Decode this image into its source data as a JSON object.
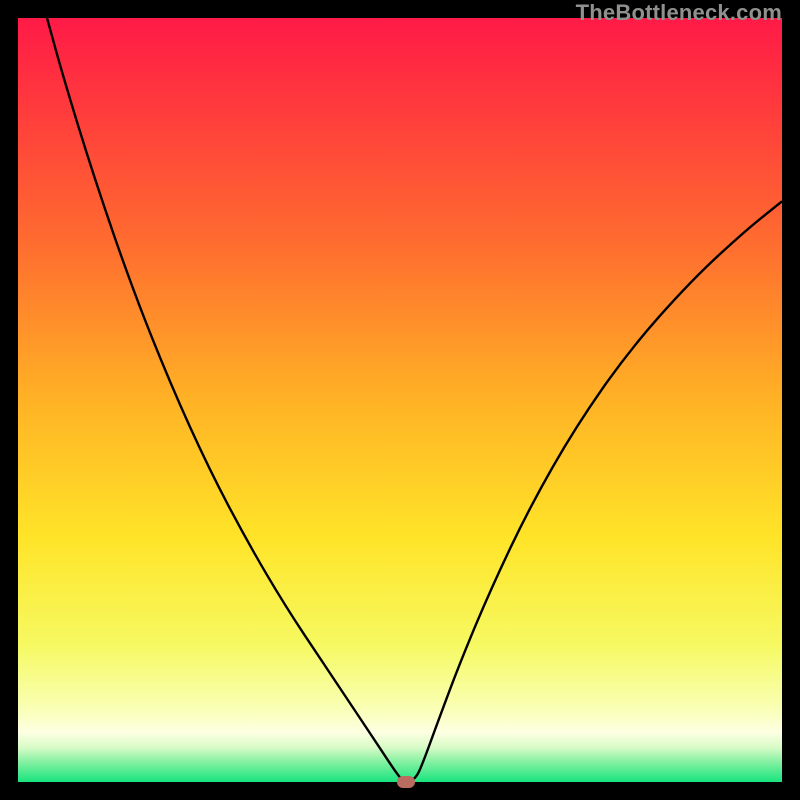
{
  "watermark": "TheBottleneck.com",
  "chart_data": {
    "type": "line",
    "title": "",
    "xlabel": "",
    "ylabel": "",
    "xlim": [
      0,
      100
    ],
    "ylim": [
      0,
      100
    ],
    "gradient_stops": [
      {
        "offset": 0.0,
        "color": "#ff1a47"
      },
      {
        "offset": 0.12,
        "color": "#ff3b3c"
      },
      {
        "offset": 0.3,
        "color": "#ff6e2f"
      },
      {
        "offset": 0.5,
        "color": "#ffb225"
      },
      {
        "offset": 0.68,
        "color": "#ffe428"
      },
      {
        "offset": 0.82,
        "color": "#f6f961"
      },
      {
        "offset": 0.9,
        "color": "#f9ffb0"
      },
      {
        "offset": 0.935,
        "color": "#fdffe2"
      },
      {
        "offset": 0.955,
        "color": "#d7fbc6"
      },
      {
        "offset": 0.975,
        "color": "#7ff09f"
      },
      {
        "offset": 1.0,
        "color": "#18e47f"
      }
    ],
    "series": [
      {
        "name": "bottleneck-curve",
        "color": "#000000",
        "points": [
          {
            "x": 3.8,
            "y": 100.0
          },
          {
            "x": 6.0,
            "y": 92.0
          },
          {
            "x": 10.0,
            "y": 79.0
          },
          {
            "x": 15.0,
            "y": 64.5
          },
          {
            "x": 20.0,
            "y": 52.0
          },
          {
            "x": 25.0,
            "y": 41.0
          },
          {
            "x": 30.0,
            "y": 31.5
          },
          {
            "x": 35.0,
            "y": 23.0
          },
          {
            "x": 40.0,
            "y": 15.5
          },
          {
            "x": 44.0,
            "y": 9.5
          },
          {
            "x": 47.0,
            "y": 5.0
          },
          {
            "x": 49.5,
            "y": 1.2
          },
          {
            "x": 50.5,
            "y": 0.0
          },
          {
            "x": 52.0,
            "y": 0.3
          },
          {
            "x": 53.0,
            "y": 2.5
          },
          {
            "x": 55.0,
            "y": 8.0
          },
          {
            "x": 58.0,
            "y": 16.0
          },
          {
            "x": 62.0,
            "y": 25.5
          },
          {
            "x": 67.0,
            "y": 36.0
          },
          {
            "x": 73.0,
            "y": 46.5
          },
          {
            "x": 80.0,
            "y": 56.5
          },
          {
            "x": 88.0,
            "y": 65.5
          },
          {
            "x": 95.0,
            "y": 72.0
          },
          {
            "x": 100.0,
            "y": 76.0
          }
        ]
      }
    ],
    "marker": {
      "x": 50.8,
      "y": 0.0,
      "color": "#bb6c60"
    }
  }
}
